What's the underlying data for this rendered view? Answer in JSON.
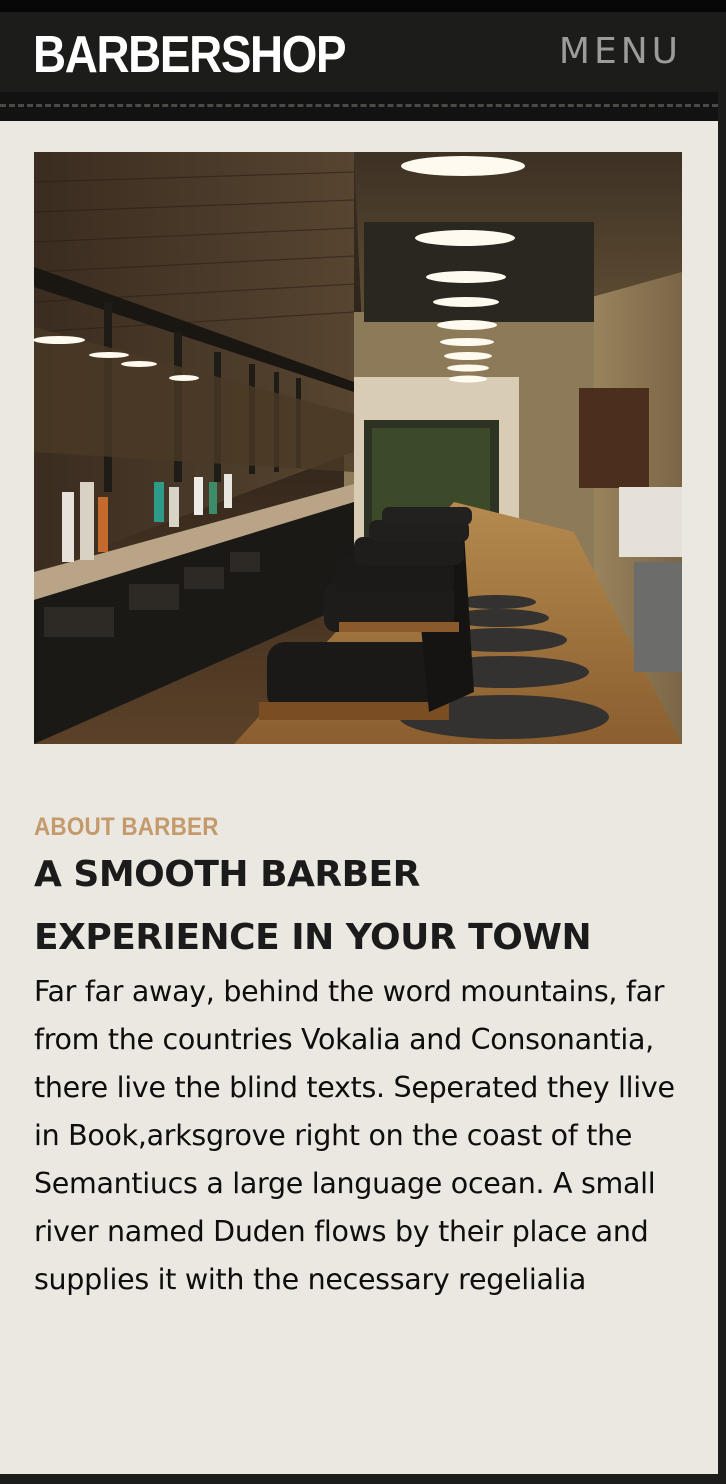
{
  "header": {
    "brand": "BARBERSHOP",
    "menu_label": "MENU"
  },
  "hero_image": {
    "description_icon": "barbershop-interior-photo"
  },
  "about": {
    "eyebrow": "ABOUT BARBER",
    "headline": "A SMOOTH BARBER EXPERIENCE IN YOUR TOWN",
    "body": "Far far away, behind the word mountains, far from the countries Vokalia and Consonantia, there live the blind texts. Seperated they llive in Book,arksgrove right on the coast of the Semantiucs a large language ocean. A small river named Duden flows by their place and supplies it with the necessary regelialia"
  },
  "colors": {
    "header_bg": "#1c1c1a",
    "content_bg": "#ebe8e1",
    "accent": "#c49a6c",
    "heading": "#1b1b1b",
    "menu": "#9c9c98"
  }
}
